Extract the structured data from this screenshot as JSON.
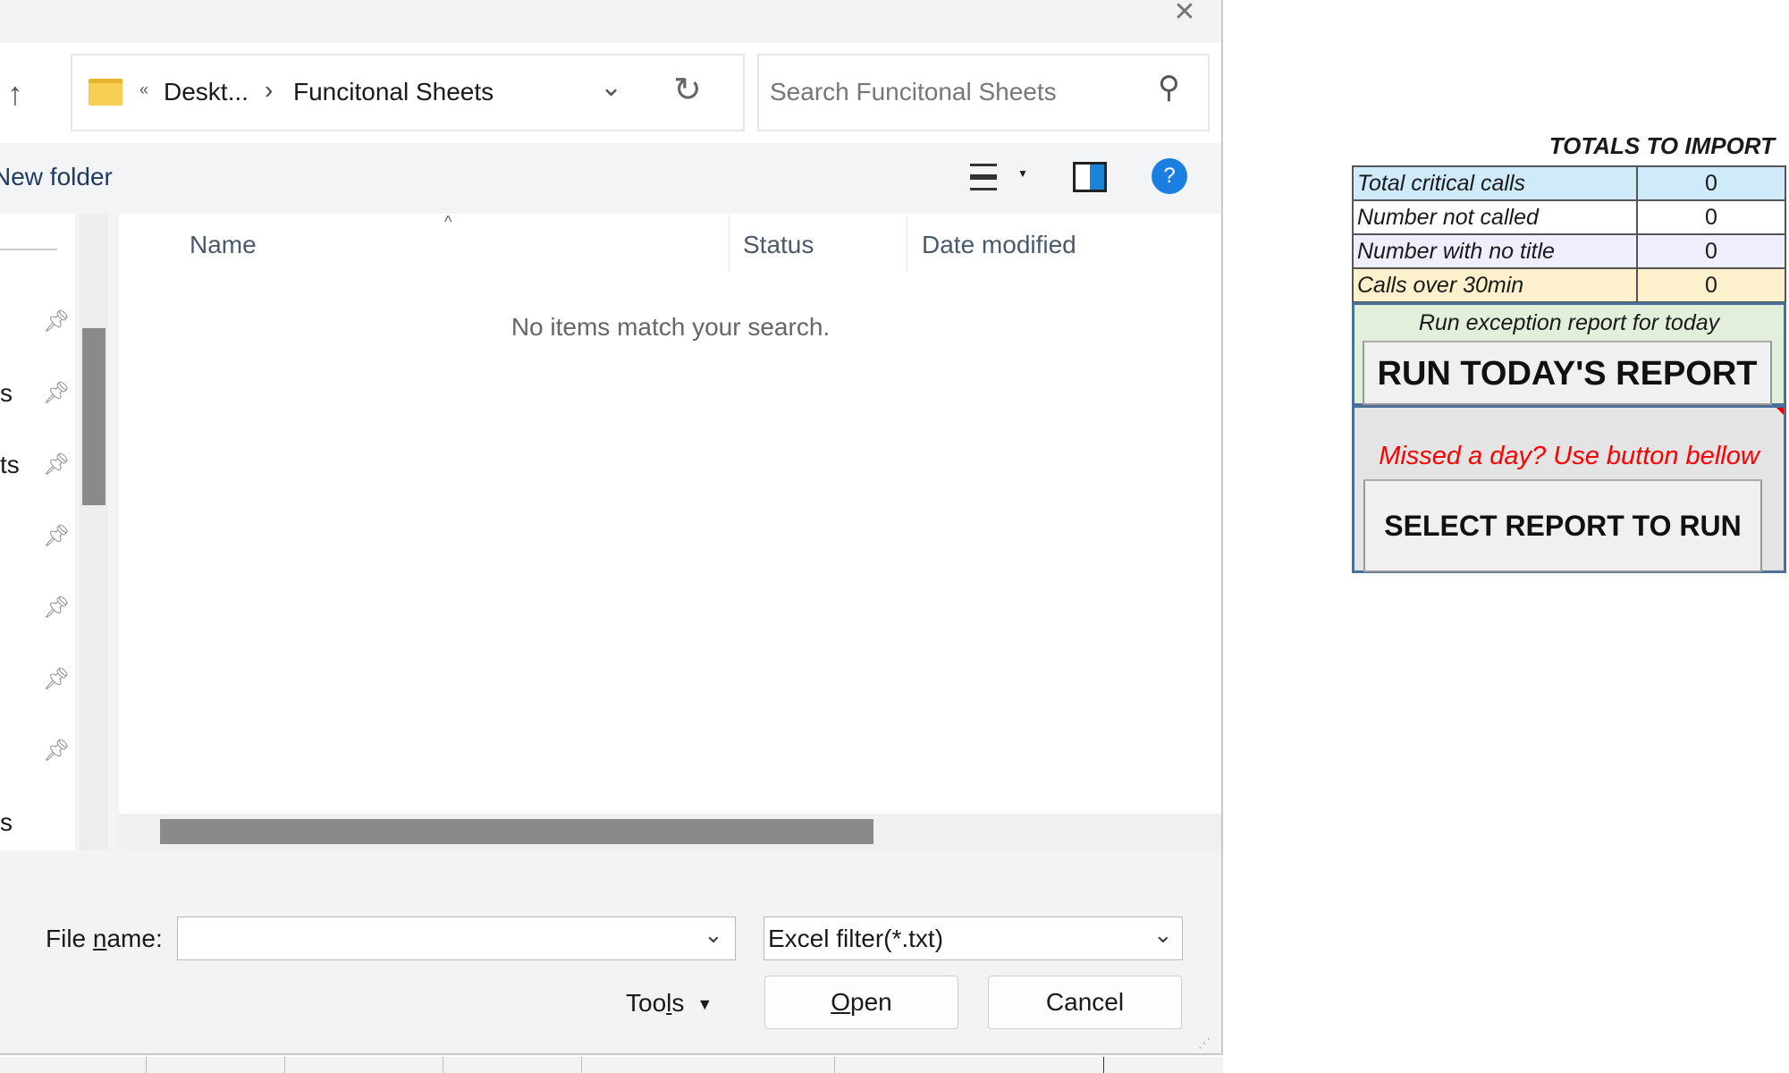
{
  "dialog": {
    "close_icon": "close-icon",
    "breadcrumb": {
      "overflow": "«",
      "parent": "Deskt...",
      "separator": "›",
      "current": "Funcitonal Sheets"
    },
    "search_placeholder": "Search Funcitonal Sheets",
    "new_folder_label": "New folder",
    "help_label": "?",
    "nav_fragments": [
      "s",
      "ts",
      "s"
    ],
    "columns": [
      "Name",
      "Status",
      "Date modified"
    ],
    "empty_message": "No items match your search.",
    "file_name_label_pre": "File ",
    "file_name_label_accel": "n",
    "file_name_label_post": "ame:",
    "file_name_value": "",
    "filter_value": "Excel filter(*.txt)",
    "tools_pre": "Too",
    "tools_accel": "l",
    "tools_post": "s",
    "open_accel": "O",
    "open_rest": "pen",
    "cancel_label": "Cancel"
  },
  "panel": {
    "title": "TOTALS TO IMPORT",
    "rows": [
      {
        "label": "Total critical calls",
        "value": "0",
        "color": "#cfeaf8"
      },
      {
        "label": "Number not called",
        "value": "0",
        "color": "#ffffff"
      },
      {
        "label": "Number with no title",
        "value": "0",
        "color": "#eeeefc"
      },
      {
        "label": "Calls over 30min",
        "value": "0",
        "color": "#fdf0cd"
      }
    ],
    "today_caption": "Run exception report for today",
    "today_button": "RUN TODAY'S REPORT",
    "missed_caption": "Missed a day? Use button bellow",
    "select_button": "SELECT REPORT TO RUN"
  }
}
